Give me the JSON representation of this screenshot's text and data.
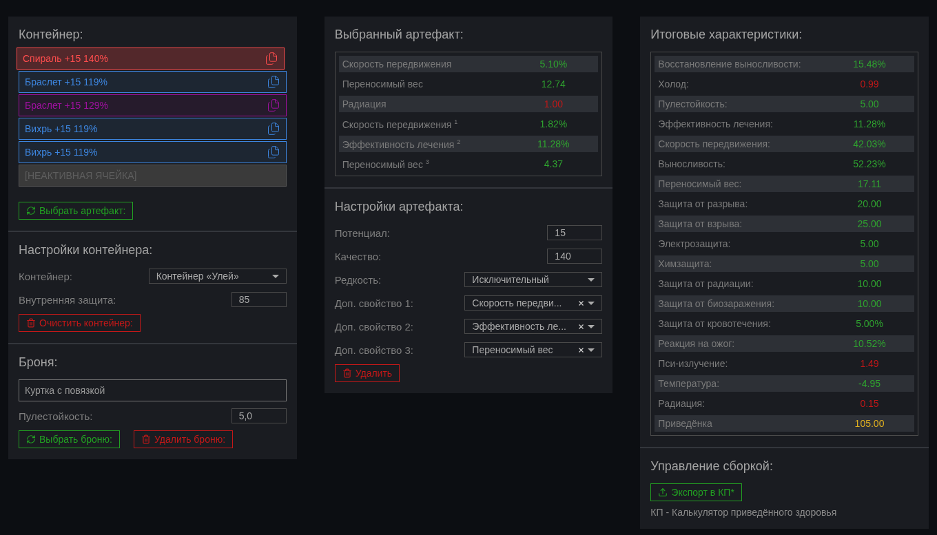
{
  "container_panel": {
    "title": "Контейнер:",
    "slots": [
      {
        "kind": "artifact",
        "label": "Спираль +15 140%",
        "color": "#ff4d4d",
        "selected": true
      },
      {
        "kind": "artifact",
        "label": "Браслет +15 119%",
        "color": "#3d86e0",
        "selected": false
      },
      {
        "kind": "artifact",
        "label": "Браслет +15 129%",
        "color": "#a010a0",
        "selected": false
      },
      {
        "kind": "artifact",
        "label": "Вихрь +15 119%",
        "color": "#3d86e0",
        "selected": false
      },
      {
        "kind": "artifact",
        "label": "Вихрь +15 119%",
        "color": "#3d86e0",
        "selected": false
      },
      {
        "kind": "inactive",
        "label": "[НЕАКТИВНАЯ ЯЧЕЙКА]"
      }
    ],
    "button": {
      "kind": "choose",
      "label": "Выбрать артефакт:"
    }
  },
  "container_settings": {
    "title": "Настройки контейнера:",
    "fields": [
      {
        "kind": "select",
        "label": "Контейнер:",
        "value": "Контейнер «Улей»"
      },
      {
        "kind": "number",
        "label": "Внутренняя защита:",
        "value": "85"
      }
    ],
    "buttons": [
      {
        "kind": "delete",
        "label": "Очистить контейнер:"
      }
    ]
  },
  "armor": {
    "title": "Броня:",
    "name": "Куртка с повязкой",
    "fields": [
      {
        "kind": "number",
        "label": "Пулестойкость:",
        "value": "5,0"
      }
    ],
    "buttons": [
      {
        "kind": "choose",
        "label": "Выбрать броню:"
      },
      {
        "kind": "delete",
        "label": "Удалить броню:"
      }
    ]
  },
  "selected_artifact": {
    "title": "Выбранный артефакт:",
    "stats": [
      {
        "name": "Скорость передвижения",
        "value": "5.10%",
        "color": "#2fa32f"
      },
      {
        "name": "Переносимый вес",
        "value": "12.74",
        "color": "#2fa32f"
      },
      {
        "name": "Радиация",
        "value": "1.00",
        "color": "#c01818"
      },
      {
        "name": "Скорость передвижения $^{1}$",
        "value": "1.82%",
        "color": "#2fa32f"
      },
      {
        "name": "Эффективность лечения $^{2}$",
        "value": "11.28%",
        "color": "#2fa32f"
      },
      {
        "name": "Переносимый вес $^{3}$",
        "value": "4.37",
        "color": "#2fa32f"
      }
    ]
  },
  "artifact_settings": {
    "title": "Настройки артефакта:",
    "fields": [
      {
        "kind": "number",
        "label": "Потенциал:",
        "value": "15"
      },
      {
        "kind": "number",
        "label": "Качество:",
        "value": "140"
      },
      {
        "kind": "select",
        "label": "Редкость:",
        "value": "Исключительный",
        "clearable": false
      },
      {
        "kind": "select",
        "label": "Доп. свойство 1:",
        "value": "Скорость передви...",
        "clearable": true
      },
      {
        "kind": "select",
        "label": "Доп. свойство 2:",
        "value": "Эффективность ле...",
        "clearable": true
      },
      {
        "kind": "select",
        "label": "Доп. свойство 3:",
        "value": "Переносимый вес",
        "clearable": true
      }
    ],
    "buttons": [
      {
        "kind": "delete",
        "label": "Удалить"
      }
    ]
  },
  "totals": {
    "title": "Итоговые характеристики:",
    "stats": [
      {
        "name": "Восстановление выносливости:",
        "value": "15.48%",
        "color": "#2fa32f"
      },
      {
        "name": "Холод:",
        "value": "0.99",
        "color": "#c01818"
      },
      {
        "name": "Пулестойкость:",
        "value": "5.00",
        "color": "#2fa32f"
      },
      {
        "name": "Эффективность лечения:",
        "value": "11.28%",
        "color": "#2fa32f"
      },
      {
        "name": "Скорость передвижения:",
        "value": "42.03%",
        "color": "#2fa32f"
      },
      {
        "name": "Выносливость:",
        "value": "52.23%",
        "color": "#2fa32f"
      },
      {
        "name": "Переносимый вес:",
        "value": "17.11",
        "color": "#2fa32f"
      },
      {
        "name": "Защита от разрыва:",
        "value": "20.00",
        "color": "#2fa32f"
      },
      {
        "name": "Защита от взрыва:",
        "value": "25.00",
        "color": "#2fa32f"
      },
      {
        "name": "Электрозащита:",
        "value": "5.00",
        "color": "#2fa32f"
      },
      {
        "name": "Химзащита:",
        "value": "5.00",
        "color": "#2fa32f"
      },
      {
        "name": "Защита от радиации:",
        "value": "10.00",
        "color": "#2fa32f"
      },
      {
        "name": "Защита от биозаражения:",
        "value": "10.00",
        "color": "#2fa32f"
      },
      {
        "name": "Защита от кровотечения:",
        "value": "5.00%",
        "color": "#2fa32f"
      },
      {
        "name": "Реакция на ожог:",
        "value": "10.52%",
        "color": "#2fa32f"
      },
      {
        "name": "Пси-излучение:",
        "value": "1.49",
        "color": "#c01818"
      },
      {
        "name": "Температура:",
        "value": "-4.95",
        "color": "#2fa32f"
      },
      {
        "name": "Радиация:",
        "value": "0.15",
        "color": "#c01818"
      },
      {
        "name": "Приведёнка",
        "value": "105.00",
        "color": "#e0b020"
      }
    ]
  },
  "build": {
    "title": "Управление сборкой:",
    "buttons": [
      {
        "kind": "export",
        "label": "Экспорт в КП*"
      }
    ],
    "note": "КП - Калькулятор приведённого здоровья"
  }
}
